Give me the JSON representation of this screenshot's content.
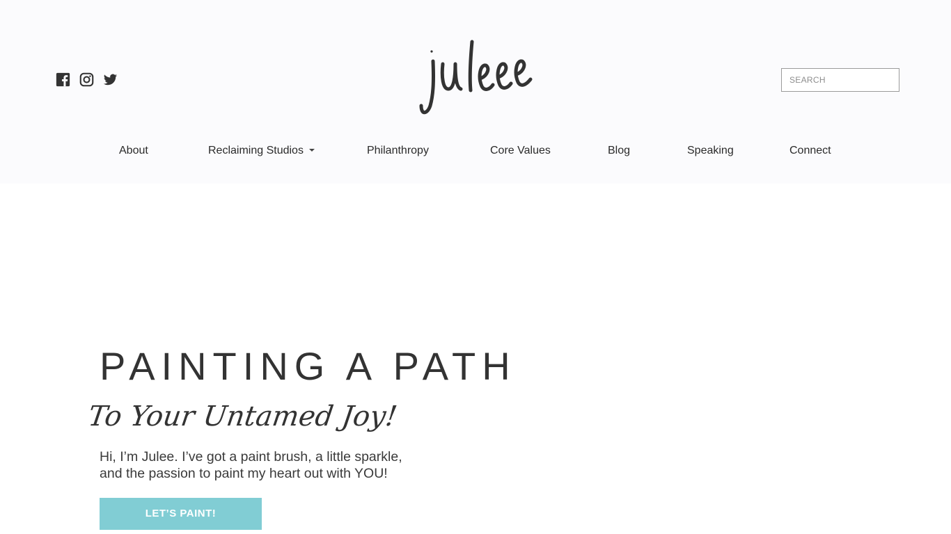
{
  "social": {
    "icons": [
      "facebook-icon",
      "instagram-icon",
      "twitter-icon"
    ]
  },
  "logo": {
    "text": "julee"
  },
  "search": {
    "placeholder": "SEARCH",
    "value": ""
  },
  "nav": {
    "items": [
      {
        "label": "About"
      },
      {
        "label": "Reclaiming Studios"
      },
      {
        "label": "Philanthropy"
      },
      {
        "label": "Core Values"
      },
      {
        "label": "Blog"
      },
      {
        "label": "Speaking"
      },
      {
        "label": "Connect"
      }
    ]
  },
  "hero": {
    "title": "PAINTING A PATH",
    "script": "To Your Untamed Joy!",
    "intro_line1": "Hi, I’m Julee. I’ve got a paint brush, a little sparkle,",
    "intro_line2": "and the passion to paint my heart out with YOU!",
    "cta_label": "LET’S PAINT!"
  },
  "colors": {
    "accent": "#81cdd4",
    "text": "#333333",
    "header_bg": "#fbfbfd"
  }
}
